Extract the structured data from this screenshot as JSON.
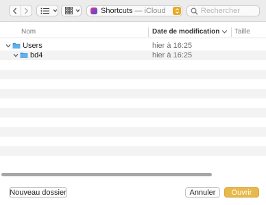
{
  "toolbar": {
    "location": {
      "name": "Shortcuts",
      "separator": "—",
      "subtitle": "iCloud"
    },
    "search": {
      "placeholder": "Rechercher",
      "value": ""
    }
  },
  "columns": {
    "name": "Nom",
    "date": "Date de modification",
    "size": "Taille"
  },
  "files": [
    {
      "name": "Users",
      "date": "hier à 16:25",
      "level": 0,
      "expanded": true
    },
    {
      "name": "bd4",
      "date": "hier à 16:25",
      "level": 1,
      "expanded": true
    }
  ],
  "buttons": {
    "new_folder": "Nouveau dossier",
    "cancel": "Annuler",
    "open": "Ouvrir"
  },
  "colors": {
    "accent": "#e8b84a",
    "folder": "#62b0e8",
    "stepper": "#e8a920"
  }
}
